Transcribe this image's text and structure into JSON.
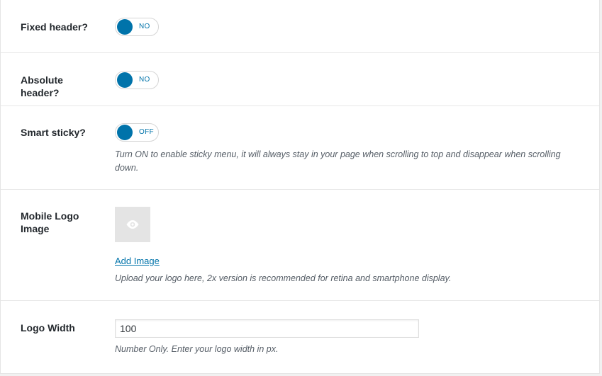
{
  "settings": {
    "fixed_header": {
      "label": "Fixed header?",
      "state": "NO"
    },
    "absolute_header": {
      "label": "Absolute header?",
      "state": "NO"
    },
    "smart_sticky": {
      "label": "Smart sticky?",
      "state": "OFF",
      "description": "Turn ON to enable sticky menu, it will always stay in your page when scrolling to top and disappear when scrolling down."
    },
    "mobile_logo": {
      "label": "Mobile Logo Image",
      "add_image_label": "Add Image",
      "description": "Upload your logo here, 2x version is recommended for retina and smartphone display."
    },
    "logo_width": {
      "label": "Logo Width",
      "value": "100",
      "description": "Number Only. Enter your logo width in px."
    }
  },
  "colors": {
    "accent": "#0073aa",
    "thumb_bg": "#e4e4e4"
  },
  "icons": {
    "thumb_icon": "eye-icon"
  }
}
